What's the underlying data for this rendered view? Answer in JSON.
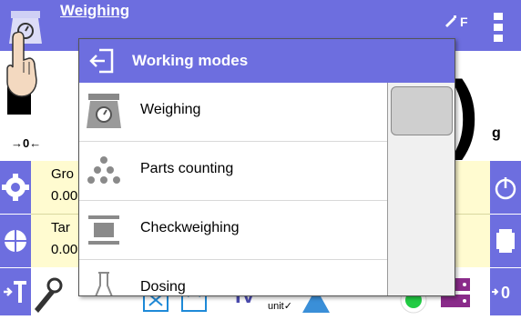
{
  "app": {
    "mode_title": "Weighing",
    "status_flag": "F"
  },
  "display": {
    "unit": "g",
    "zero_indicator": "→0←"
  },
  "info_panel": {
    "rows": [
      {
        "label": "Gro",
        "value": "0.00"
      },
      {
        "label": "Tar",
        "value": "0.00"
      }
    ]
  },
  "dialog": {
    "title": "Working modes",
    "items": [
      {
        "label": "Weighing",
        "icon": "scale-icon"
      },
      {
        "label": "Parts counting",
        "icon": "parts-counting-icon"
      },
      {
        "label": "Checkweighing",
        "icon": "checkweighing-icon"
      },
      {
        "label": "Dosing",
        "icon": "dosing-icon"
      }
    ]
  },
  "toolbar": {
    "unit_label": "unit"
  },
  "colors": {
    "accent": "#6d6edf",
    "info_bg": "#fffbd0",
    "dialog_bg": "#ffffff",
    "scroll_track": "#f0f0f0"
  }
}
